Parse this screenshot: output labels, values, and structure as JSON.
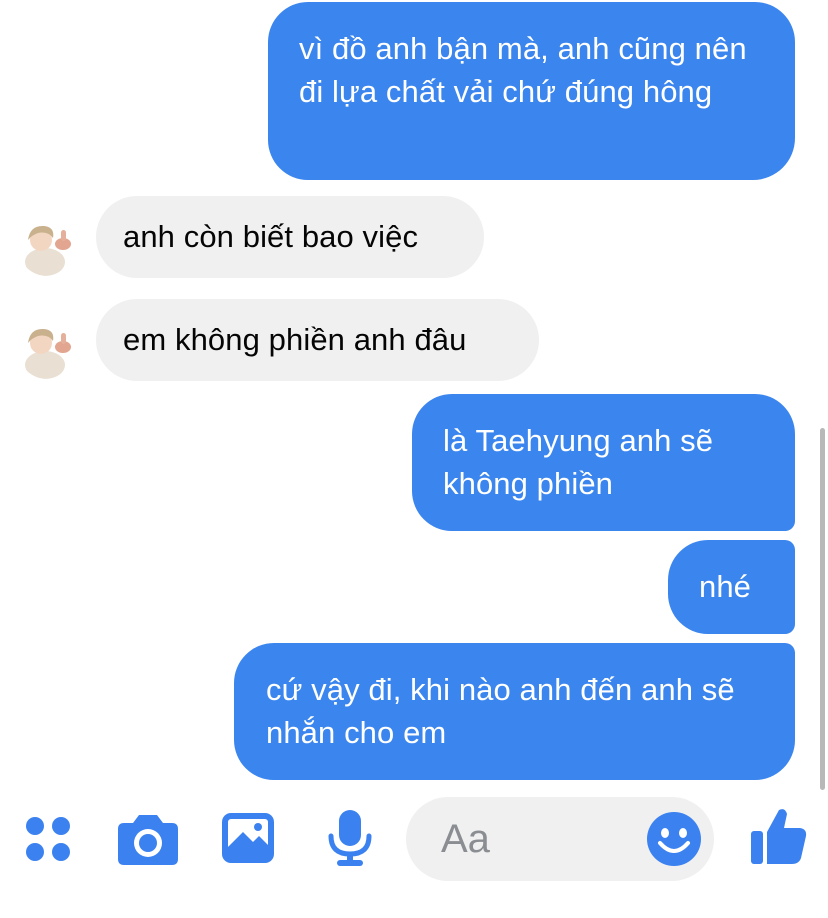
{
  "conversation": {
    "messages": [
      {
        "direction": "sent",
        "text": "vì đồ anh bận mà, anh cũng nên đi lựa chất vải chứ đúng hông"
      },
      {
        "direction": "received",
        "text": "anh còn biết bao việc"
      },
      {
        "direction": "received",
        "text": "em không phiền anh đâu"
      },
      {
        "direction": "sent",
        "text": "là Taehyung anh sẽ không phiền"
      },
      {
        "direction": "sent",
        "text": "nhé"
      },
      {
        "direction": "sent",
        "text": "cứ vậy đi, khi nào anh đến anh sẽ nhắn cho em"
      }
    ]
  },
  "composer": {
    "input_placeholder": "Aa",
    "icons": [
      "apps-icon",
      "camera-icon",
      "image-icon",
      "microphone-icon",
      "emoji-icon",
      "like-icon"
    ]
  },
  "colors": {
    "sent_bubble": "#3b85ee",
    "received_bubble": "#f0f0f0",
    "accent_icon": "#3b82f0",
    "placeholder": "#8a8d91"
  }
}
